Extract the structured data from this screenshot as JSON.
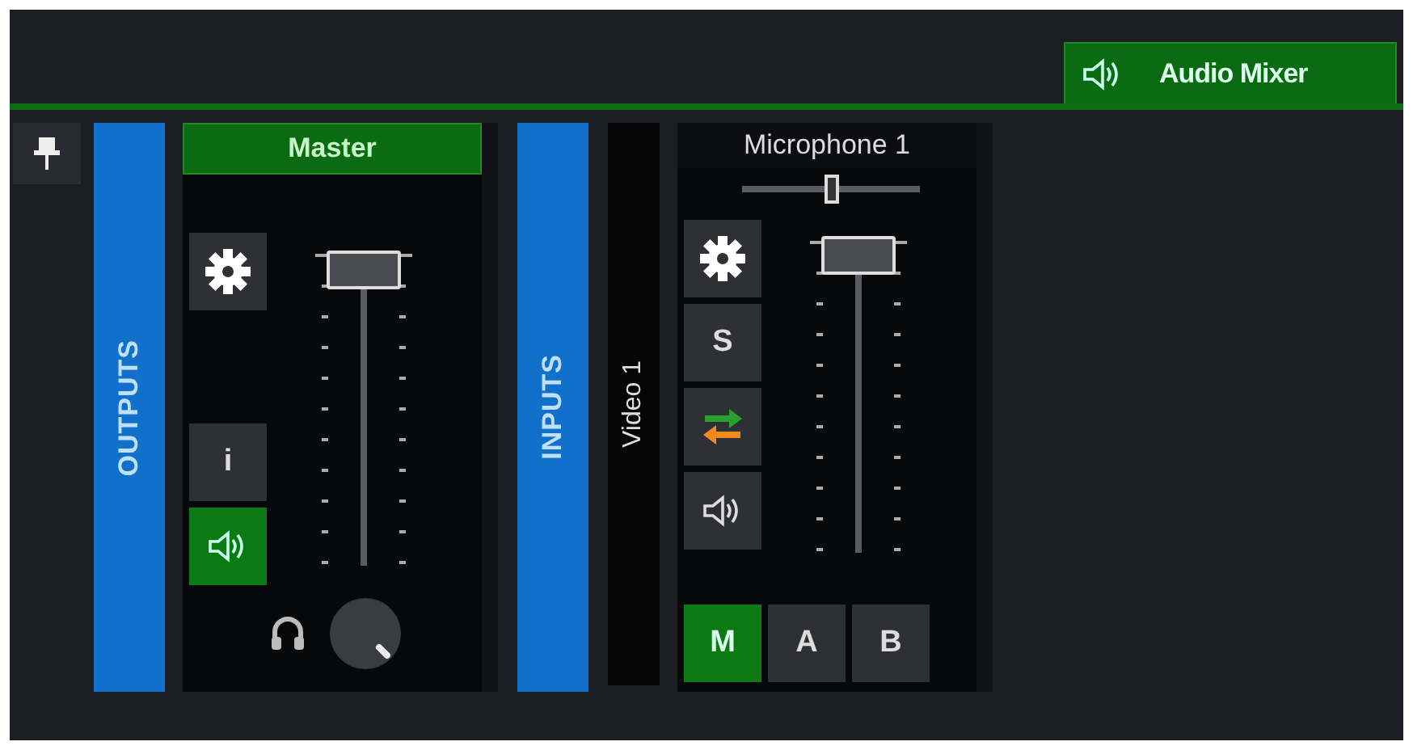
{
  "header": {
    "tab": {
      "label": "Audio Mixer",
      "selected": true
    }
  },
  "sections": [
    {
      "label": "OUTPUTS",
      "strips": [
        {
          "title": "Master",
          "kind": "bus",
          "button_groups": [
            [
              {
                "kind": "settings"
              }
            ],
            [
              {
                "kind": "info",
                "label": "i"
              },
              {
                "kind": "audio",
                "on": true
              }
            ]
          ],
          "fader": {
            "level": 0.94
          },
          "footer": {
            "kind": "monitor"
          }
        }
      ]
    },
    {
      "label": "INPUTS",
      "group_label": "Video 1",
      "strips": [
        {
          "title": "Microphone 1",
          "kind": "input",
          "pan": {
            "level": 0.5
          },
          "button_groups": [
            [
              {
                "kind": "settings"
              },
              {
                "kind": "solo",
                "label": "S",
                "on": false
              },
              {
                "kind": "route"
              },
              {
                "kind": "audio",
                "on": false
              }
            ]
          ],
          "fader": {
            "level": 0.95
          },
          "footer": {
            "kind": "buses",
            "buses": [
              {
                "label": "M",
                "on": true
              },
              {
                "label": "A",
                "on": false
              },
              {
                "label": "B",
                "on": false
              }
            ]
          }
        }
      ]
    }
  ]
}
